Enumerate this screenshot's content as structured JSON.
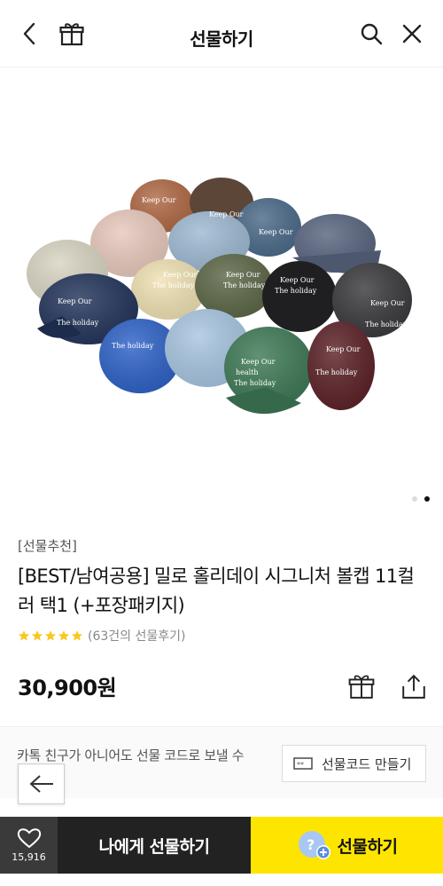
{
  "header": {
    "title": "선물하기",
    "back_icon": "chevron-left-icon",
    "gift_icon": "gift-icon",
    "search_icon": "search-icon",
    "close_icon": "close-icon"
  },
  "gallery": {
    "slide_count": 2,
    "active_slide": 2,
    "hat_texts": [
      "Keep Our health The holiday"
    ]
  },
  "product": {
    "category": "[선물추천]",
    "name": "[BEST/남여공용] 밀로 홀리데이 시그니처 볼캡 11컬러 택1 (+포장패키지)",
    "rating_stars": 5,
    "review_text": "(63건의 선물후기)",
    "price": "30,900원"
  },
  "banner": {
    "text": "카톡 친구가 아니어도 선물 코드로 보낼 수 있어요!",
    "code_button_label": "선물코드 만들기"
  },
  "bottom_bar": {
    "wish_count": "15,916",
    "self_gift_label": "나에게 선물하기",
    "gift_label": "선물하기"
  },
  "colors": {
    "accent_yellow": "#fee500",
    "star_yellow": "#f9c81f",
    "dark": "#222222"
  }
}
